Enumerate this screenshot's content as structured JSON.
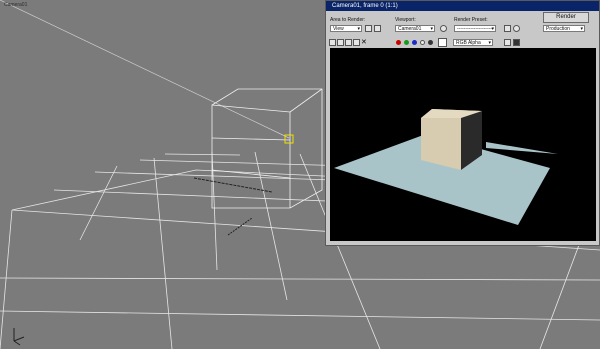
{
  "viewport": {
    "label": "Camera01"
  },
  "render_window": {
    "title": "Camera01, frame 0 (1:1)",
    "area_to_render_label": "Area to Render:",
    "area_to_render_value": "View",
    "viewport_label": "Viewport:",
    "viewport_value": "Camera01",
    "render_preset_label": "Render Preset:",
    "render_preset_value": "----------------------",
    "render_button": "Render",
    "production_value": "Production",
    "channel_value": "RGB Alpha"
  },
  "colors": {
    "viewport_bg": "#7b7b7b",
    "grid_line": "#e8e8e8",
    "title_bar": "#0a246a",
    "render_bg": "#000000",
    "plane": "#a9c4c8",
    "box_front": "#d8ccb0",
    "red_channel": "#cc0000",
    "green_channel": "#1a9a1a",
    "blue_channel": "#1a2acc"
  }
}
